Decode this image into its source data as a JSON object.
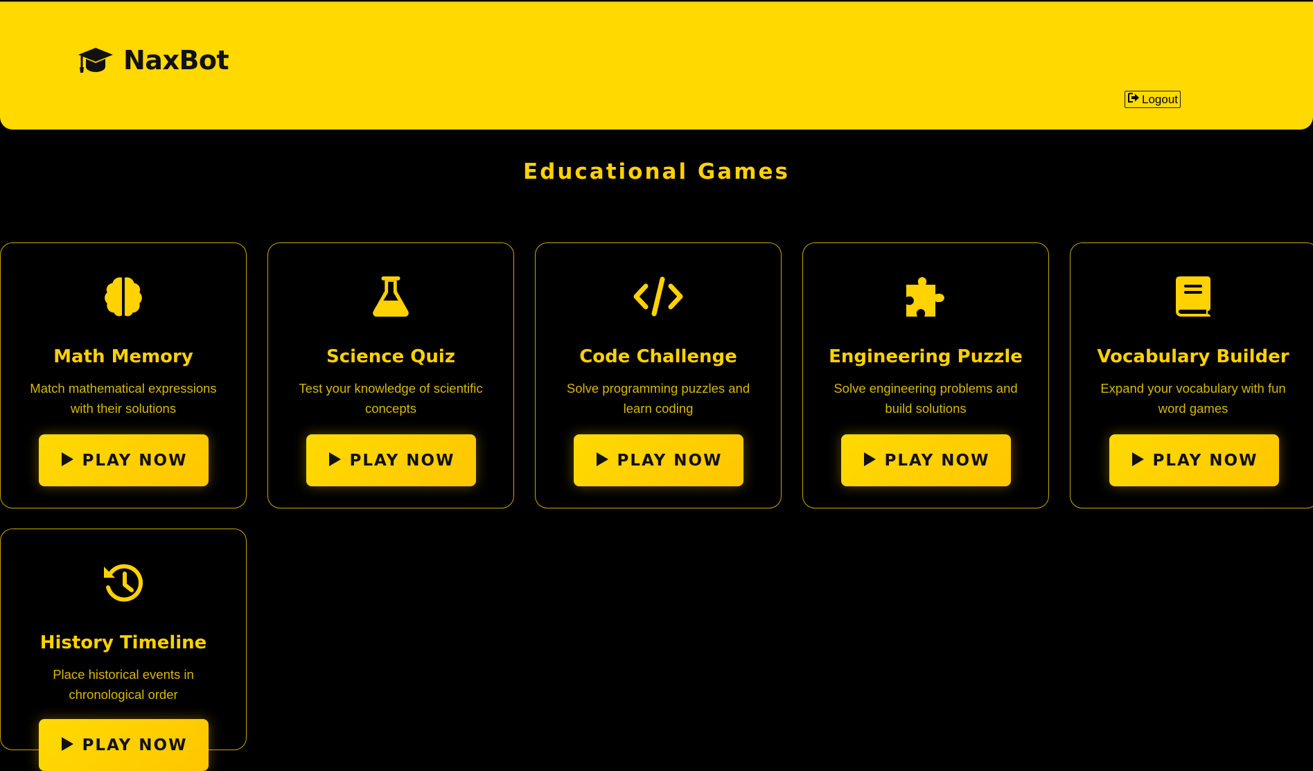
{
  "header": {
    "brand_icon": "graduation-cap-icon",
    "brand_name": "NaxBot",
    "logout_icon": "logout-icon",
    "logout_label": "Logout"
  },
  "main": {
    "title": "Educational Games",
    "games": [
      {
        "icon": "brain-icon",
        "title": "Math Memory",
        "description": "Match mathematical expressions with their solutions",
        "button_label": "PLAY NOW"
      },
      {
        "icon": "flask-icon",
        "title": "Science Quiz",
        "description": "Test your knowledge of scientific concepts",
        "button_label": "PLAY NOW"
      },
      {
        "icon": "code-icon",
        "title": "Code Challenge",
        "description": "Solve programming puzzles and learn coding",
        "button_label": "PLAY NOW"
      },
      {
        "icon": "puzzle-icon",
        "title": "Engineering Puzzle",
        "description": "Solve engineering problems and build solutions",
        "button_label": "PLAY NOW"
      },
      {
        "icon": "book-icon",
        "title": "Vocabulary Builder",
        "description": "Expand your vocabulary with fun word games",
        "button_label": "PLAY NOW"
      },
      {
        "icon": "history-icon",
        "title": "History Timeline",
        "description": "Place historical events in chronological order",
        "button_label": "PLAY NOW"
      }
    ]
  },
  "colors": {
    "header_background": "#FFD900",
    "page_background": "#000000",
    "accent": "#FFD200"
  }
}
